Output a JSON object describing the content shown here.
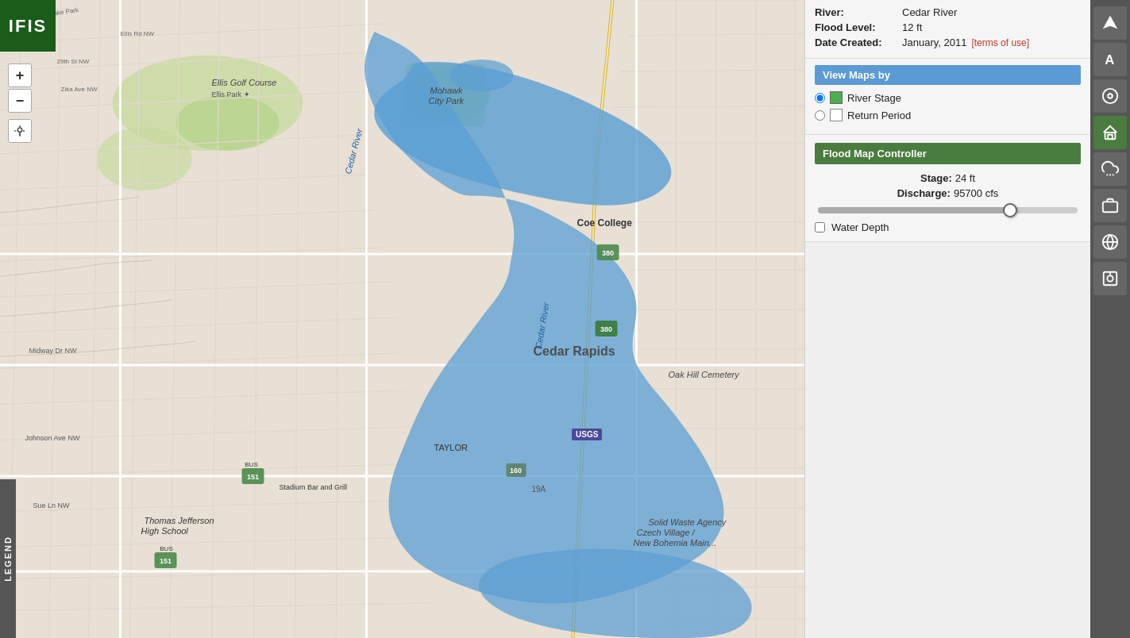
{
  "app": {
    "logo": "IFIS",
    "legend_label": "LEGEND"
  },
  "map": {
    "zoom_in": "+",
    "zoom_out": "−",
    "location_icon": "📍",
    "usgs_label": "USGS"
  },
  "info_panel": {
    "river_label": "River:",
    "river_value": "Cedar River",
    "flood_level_label": "Flood Level:",
    "flood_level_value": "12 ft",
    "date_created_label": "Date Created:",
    "date_created_value": "January, 2011",
    "terms_link": "[terms of use]"
  },
  "view_maps": {
    "header": "View Maps by",
    "options": [
      {
        "id": "river-stage",
        "label": "River Stage",
        "color": "#4caf50",
        "checked": true
      },
      {
        "id": "return-period",
        "label": "Return Period",
        "color": "#ffffff",
        "checked": false
      }
    ]
  },
  "flood_controller": {
    "header": "Flood Map Controller",
    "stage_label": "Stage:",
    "stage_value": "24 ft",
    "discharge_label": "Discharge:",
    "discharge_value": "95700 cfs",
    "slider_percent": 74,
    "water_depth_label": "Water Depth",
    "water_depth_checked": false
  },
  "icon_bar": {
    "icons": [
      {
        "name": "navigation-icon",
        "symbol": "➤",
        "active": false
      },
      {
        "name": "text-icon",
        "symbol": "A",
        "active": false
      },
      {
        "name": "satellite-icon",
        "symbol": "📡",
        "active": false
      },
      {
        "name": "home-icon",
        "symbol": "🏠",
        "active": true
      },
      {
        "name": "rain-icon",
        "symbol": "🌧",
        "active": false
      },
      {
        "name": "briefcase-icon",
        "symbol": "💼",
        "active": false
      },
      {
        "name": "globe-icon",
        "symbol": "🌐",
        "active": false
      },
      {
        "name": "camera-icon",
        "symbol": "📷",
        "active": false
      }
    ]
  }
}
